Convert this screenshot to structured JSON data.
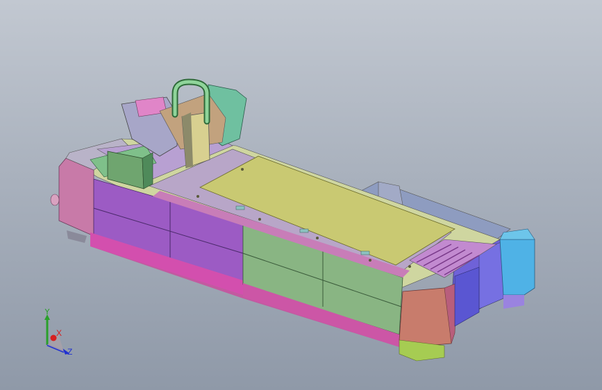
{
  "viewport": {
    "background_top": "#c2c8d1",
    "background_bottom": "#8f99a8"
  },
  "triad": {
    "x_label": "X",
    "y_label": "Y",
    "z_label": "Z",
    "x_color": "#d62020",
    "y_color": "#2aa02a",
    "z_color": "#2030d0"
  },
  "model": {
    "name_icon": "laser-cutting-machine-3d-model"
  }
}
